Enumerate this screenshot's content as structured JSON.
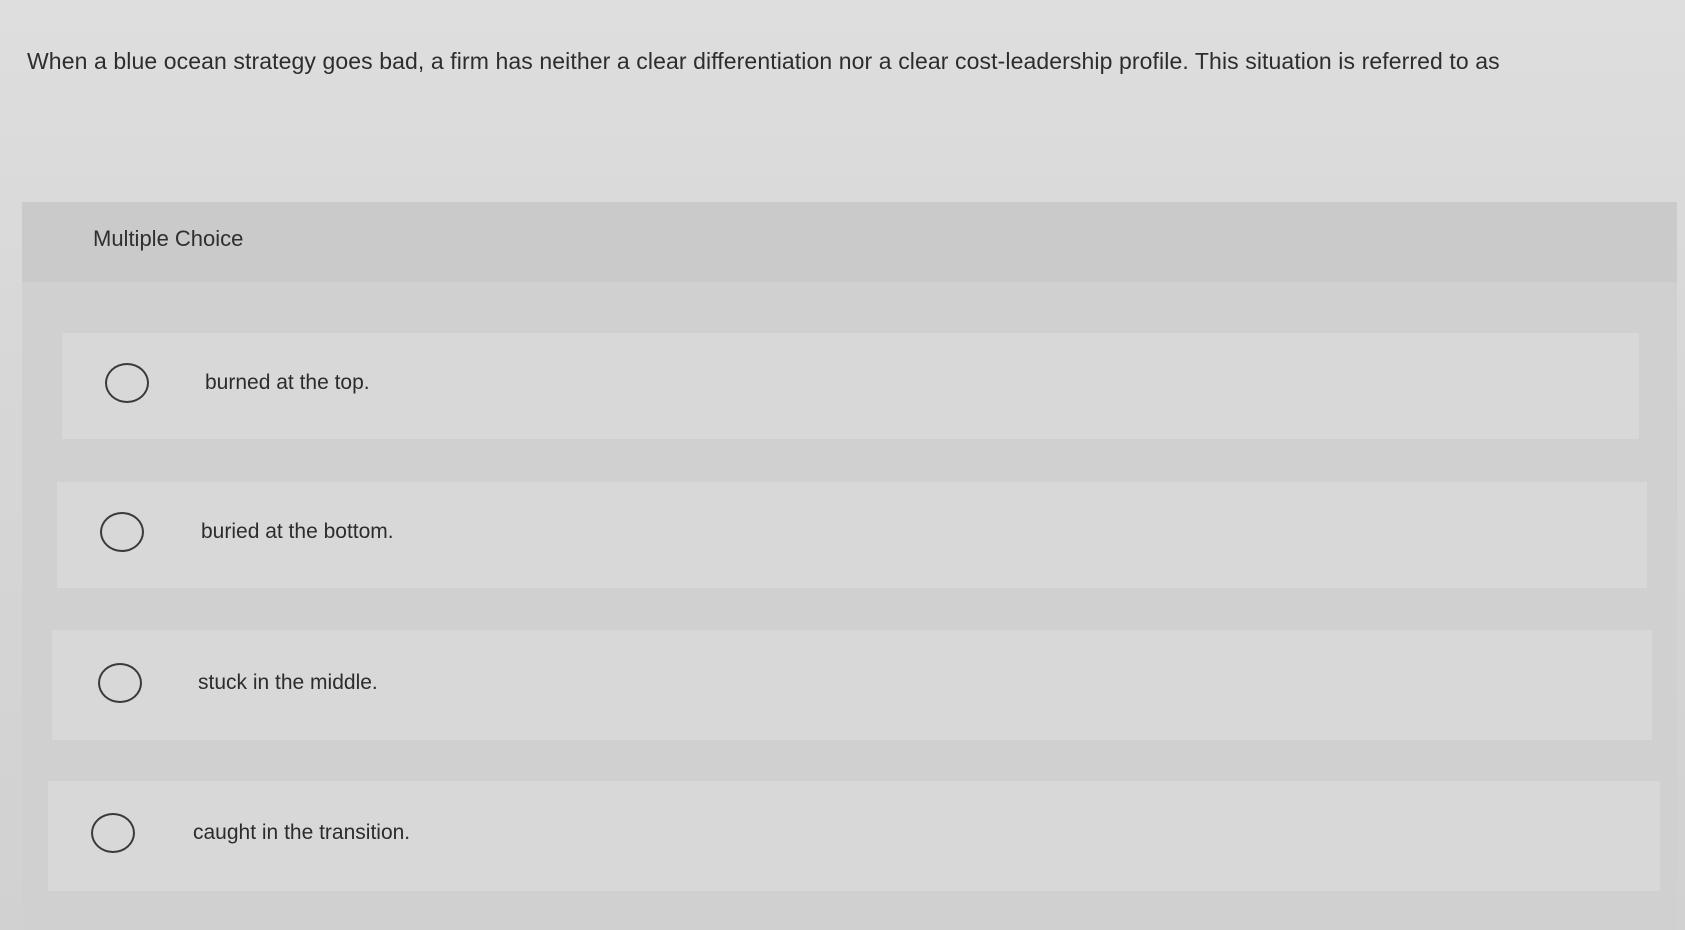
{
  "question": {
    "text": "When a blue ocean strategy goes bad, a firm has neither a clear differentiation nor a clear cost-leadership profile. This situation is referred to as"
  },
  "multiple_choice": {
    "title": "Multiple Choice",
    "options": [
      {
        "label": "burned at the top."
      },
      {
        "label": "buried at the bottom."
      },
      {
        "label": "stuck in the middle."
      },
      {
        "label": "caught in the transition."
      }
    ]
  }
}
